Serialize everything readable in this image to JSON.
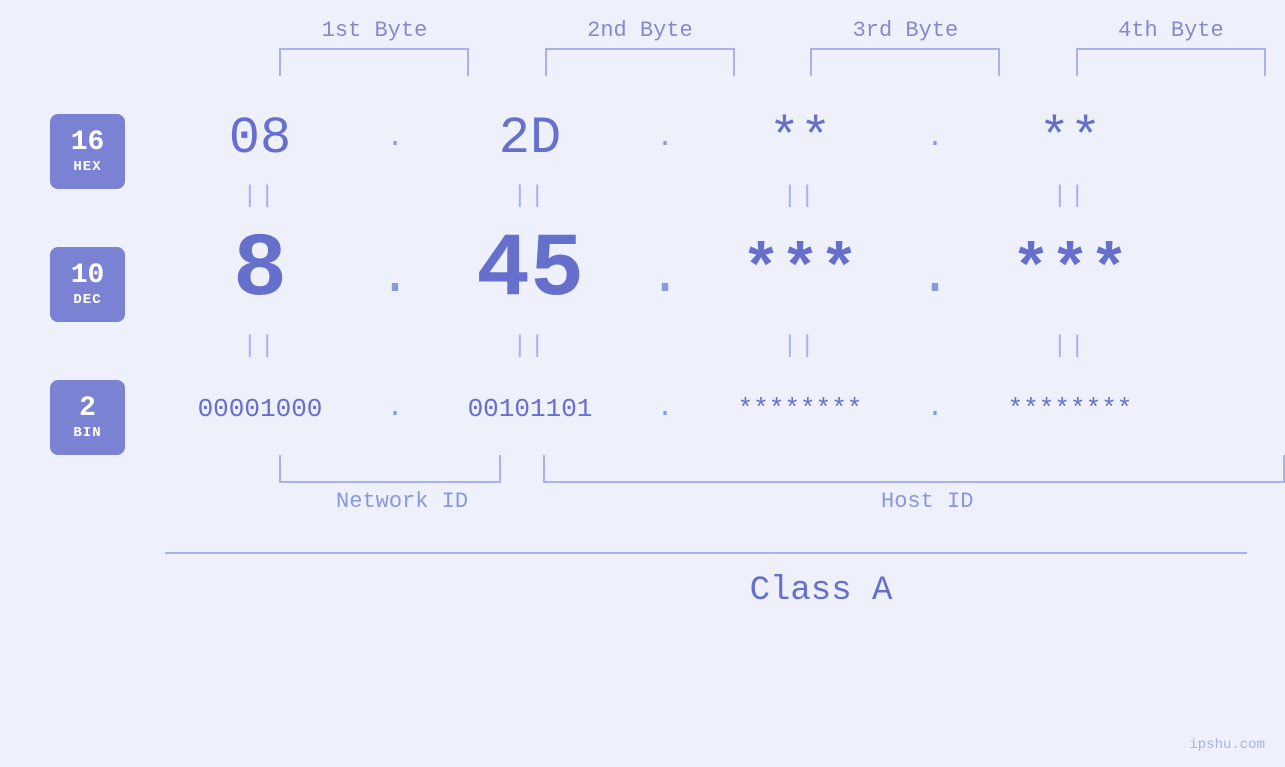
{
  "header": {
    "byte1": "1st Byte",
    "byte2": "2nd Byte",
    "byte3": "3rd Byte",
    "byte4": "4th Byte"
  },
  "badges": {
    "hex": {
      "number": "16",
      "label": "HEX"
    },
    "dec": {
      "number": "10",
      "label": "DEC"
    },
    "bin": {
      "number": "2",
      "label": "BIN"
    }
  },
  "bytes": {
    "b1": {
      "hex": "08",
      "dec": "8",
      "bin": "00001000"
    },
    "b2": {
      "hex": "2D",
      "dec": "45",
      "bin": "00101101"
    },
    "b3": {
      "hex": "**",
      "dec": "***",
      "bin": "********"
    },
    "b4": {
      "hex": "**",
      "dec": "***",
      "bin": "********"
    }
  },
  "labels": {
    "network_id": "Network ID",
    "host_id": "Host ID",
    "class": "Class A"
  },
  "watermark": "ipshu.com"
}
